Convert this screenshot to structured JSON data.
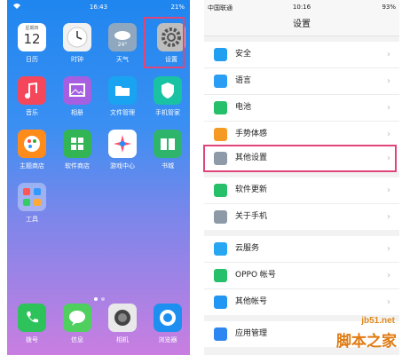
{
  "home": {
    "status": {
      "time": "16:43",
      "battery": "21%"
    },
    "apps": [
      {
        "label": "日历",
        "icon": "calendar-icon",
        "day": "12",
        "weekday": "星期四"
      },
      {
        "label": "时钟",
        "icon": "clock-icon"
      },
      {
        "label": "天气",
        "icon": "weather-icon",
        "temp": "24°"
      },
      {
        "label": "设置",
        "icon": "gear-icon"
      },
      {
        "label": "音乐",
        "icon": "music-icon"
      },
      {
        "label": "相册",
        "icon": "gallery-icon"
      },
      {
        "label": "文件管理",
        "icon": "folder-icon"
      },
      {
        "label": "手机管家",
        "icon": "shield-icon"
      },
      {
        "label": "主题商店",
        "icon": "palette-icon"
      },
      {
        "label": "软件商店",
        "icon": "store-icon"
      },
      {
        "label": "游戏中心",
        "icon": "game-icon"
      },
      {
        "label": "书城",
        "icon": "book-icon"
      },
      {
        "label": "工具",
        "icon": "tools-folder-icon"
      }
    ],
    "dock": [
      {
        "label": "拨号",
        "icon": "phone-icon"
      },
      {
        "label": "信息",
        "icon": "message-icon"
      },
      {
        "label": "相机",
        "icon": "camera-icon"
      },
      {
        "label": "浏览器",
        "icon": "browser-icon"
      }
    ]
  },
  "settings": {
    "status": {
      "carrier": "中国联通",
      "time": "10:16",
      "battery": "93%"
    },
    "title": "设置",
    "groups": [
      [
        {
          "label": "安全",
          "icon": "shield-icon"
        },
        {
          "label": "语言",
          "icon": "language-icon"
        },
        {
          "label": "电池",
          "icon": "battery-icon"
        },
        {
          "label": "手势体感",
          "icon": "hand-gesture-icon"
        }
      ],
      [
        {
          "label": "其他设置",
          "icon": "more-dots-icon"
        }
      ],
      [
        {
          "label": "软件更新",
          "icon": "update-icon"
        },
        {
          "label": "关于手机",
          "icon": "info-icon"
        }
      ],
      [
        {
          "label": "云服务",
          "icon": "cloud-icon"
        },
        {
          "label": "OPPO 帐号",
          "icon": "account-icon"
        },
        {
          "label": "其他帐号",
          "icon": "user-icon"
        }
      ],
      [
        {
          "label": "应用管理",
          "icon": "apps-icon"
        }
      ]
    ]
  },
  "watermark": {
    "site": "jb51.net",
    "name": "脚本之家"
  },
  "colors": {
    "highlight": "#e0457a"
  }
}
